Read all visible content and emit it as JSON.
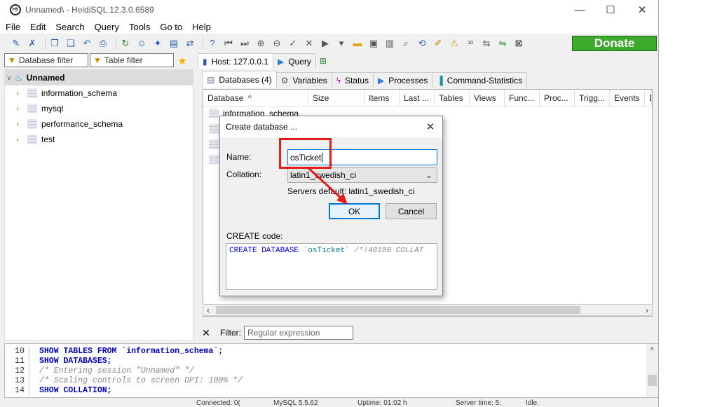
{
  "window": {
    "title": "Unnamed\\ - HeidiSQL 12.3.0.6589",
    "min": "—",
    "max": "☐",
    "close": "✕"
  },
  "menu": [
    "File",
    "Edit",
    "Search",
    "Query",
    "Tools",
    "Go to",
    "Help"
  ],
  "toolbar": {
    "donate_label": "Donate"
  },
  "filters": {
    "database": "Database filter",
    "table": "Table filter"
  },
  "tree": {
    "root": "Unnamed",
    "items": [
      "information_schema",
      "mysql",
      "performance_schema",
      "test"
    ]
  },
  "host_tab": {
    "label": "Host: 127.0.0.1",
    "query_label": "Query"
  },
  "sub_tabs": [
    "Databases (4)",
    "Variables",
    "Status",
    "Processes",
    "Command-Statistics"
  ],
  "grid": {
    "columns": [
      "Database",
      "Size",
      "Items",
      "Last ...",
      "Tables",
      "Views",
      "Func...",
      "Proc...",
      "Trigg...",
      "Events",
      "D"
    ],
    "first_row": "information_schema"
  },
  "filter_bar": {
    "label": "Filter:",
    "placeholder": "Regular expression"
  },
  "sql_log": [
    {
      "n": "10",
      "text": "SHOW TABLES FROM `information_schema`;"
    },
    {
      "n": "11",
      "text": "SHOW DATABASES;"
    },
    {
      "n": "12",
      "text": "/* Entering session \"Unnamed\" */"
    },
    {
      "n": "13",
      "text": "/* Scaling controls to screen DPI: 100% */"
    },
    {
      "n": "14",
      "text": "SHOW COLLATION;"
    }
  ],
  "status": [
    "Connected: 0(",
    "MySQL 5.5.62",
    "Uptime: 01:02 h",
    "Server time: 5:",
    "Idle."
  ],
  "dialog": {
    "title": "Create database ...",
    "name_label": "Name:",
    "name_value": "osTicket",
    "collation_label": "Collation:",
    "collation_value": "latin1_swedish_ci",
    "server_default": "Servers default: latin1_swedish_ci",
    "ok_label": "OK",
    "cancel_label": "Cancel",
    "create_code_label": "CREATE code:",
    "code_kw": "CREATE DATABASE",
    "code_name": "`osTicket`",
    "code_comment": "/*!40100 COLLAT"
  },
  "colors": {
    "accent": "#0078d7",
    "donate": "#3caa2c",
    "highlight": "#e31b1b"
  }
}
